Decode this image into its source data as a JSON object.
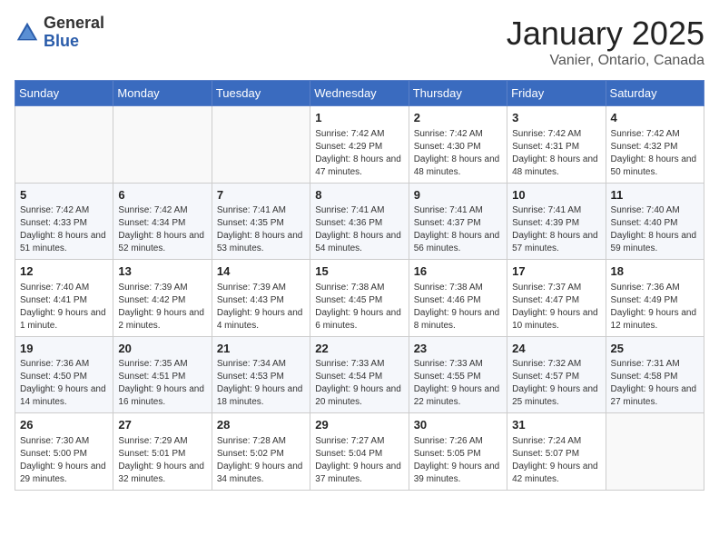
{
  "logo": {
    "general": "General",
    "blue": "Blue"
  },
  "header": {
    "month": "January 2025",
    "location": "Vanier, Ontario, Canada"
  },
  "weekdays": [
    "Sunday",
    "Monday",
    "Tuesday",
    "Wednesday",
    "Thursday",
    "Friday",
    "Saturday"
  ],
  "weeks": [
    [
      {
        "day": "",
        "info": ""
      },
      {
        "day": "",
        "info": ""
      },
      {
        "day": "",
        "info": ""
      },
      {
        "day": "1",
        "info": "Sunrise: 7:42 AM\nSunset: 4:29 PM\nDaylight: 8 hours and 47 minutes."
      },
      {
        "day": "2",
        "info": "Sunrise: 7:42 AM\nSunset: 4:30 PM\nDaylight: 8 hours and 48 minutes."
      },
      {
        "day": "3",
        "info": "Sunrise: 7:42 AM\nSunset: 4:31 PM\nDaylight: 8 hours and 48 minutes."
      },
      {
        "day": "4",
        "info": "Sunrise: 7:42 AM\nSunset: 4:32 PM\nDaylight: 8 hours and 50 minutes."
      }
    ],
    [
      {
        "day": "5",
        "info": "Sunrise: 7:42 AM\nSunset: 4:33 PM\nDaylight: 8 hours and 51 minutes."
      },
      {
        "day": "6",
        "info": "Sunrise: 7:42 AM\nSunset: 4:34 PM\nDaylight: 8 hours and 52 minutes."
      },
      {
        "day": "7",
        "info": "Sunrise: 7:41 AM\nSunset: 4:35 PM\nDaylight: 8 hours and 53 minutes."
      },
      {
        "day": "8",
        "info": "Sunrise: 7:41 AM\nSunset: 4:36 PM\nDaylight: 8 hours and 54 minutes."
      },
      {
        "day": "9",
        "info": "Sunrise: 7:41 AM\nSunset: 4:37 PM\nDaylight: 8 hours and 56 minutes."
      },
      {
        "day": "10",
        "info": "Sunrise: 7:41 AM\nSunset: 4:39 PM\nDaylight: 8 hours and 57 minutes."
      },
      {
        "day": "11",
        "info": "Sunrise: 7:40 AM\nSunset: 4:40 PM\nDaylight: 8 hours and 59 minutes."
      }
    ],
    [
      {
        "day": "12",
        "info": "Sunrise: 7:40 AM\nSunset: 4:41 PM\nDaylight: 9 hours and 1 minute."
      },
      {
        "day": "13",
        "info": "Sunrise: 7:39 AM\nSunset: 4:42 PM\nDaylight: 9 hours and 2 minutes."
      },
      {
        "day": "14",
        "info": "Sunrise: 7:39 AM\nSunset: 4:43 PM\nDaylight: 9 hours and 4 minutes."
      },
      {
        "day": "15",
        "info": "Sunrise: 7:38 AM\nSunset: 4:45 PM\nDaylight: 9 hours and 6 minutes."
      },
      {
        "day": "16",
        "info": "Sunrise: 7:38 AM\nSunset: 4:46 PM\nDaylight: 9 hours and 8 minutes."
      },
      {
        "day": "17",
        "info": "Sunrise: 7:37 AM\nSunset: 4:47 PM\nDaylight: 9 hours and 10 minutes."
      },
      {
        "day": "18",
        "info": "Sunrise: 7:36 AM\nSunset: 4:49 PM\nDaylight: 9 hours and 12 minutes."
      }
    ],
    [
      {
        "day": "19",
        "info": "Sunrise: 7:36 AM\nSunset: 4:50 PM\nDaylight: 9 hours and 14 minutes."
      },
      {
        "day": "20",
        "info": "Sunrise: 7:35 AM\nSunset: 4:51 PM\nDaylight: 9 hours and 16 minutes."
      },
      {
        "day": "21",
        "info": "Sunrise: 7:34 AM\nSunset: 4:53 PM\nDaylight: 9 hours and 18 minutes."
      },
      {
        "day": "22",
        "info": "Sunrise: 7:33 AM\nSunset: 4:54 PM\nDaylight: 9 hours and 20 minutes."
      },
      {
        "day": "23",
        "info": "Sunrise: 7:33 AM\nSunset: 4:55 PM\nDaylight: 9 hours and 22 minutes."
      },
      {
        "day": "24",
        "info": "Sunrise: 7:32 AM\nSunset: 4:57 PM\nDaylight: 9 hours and 25 minutes."
      },
      {
        "day": "25",
        "info": "Sunrise: 7:31 AM\nSunset: 4:58 PM\nDaylight: 9 hours and 27 minutes."
      }
    ],
    [
      {
        "day": "26",
        "info": "Sunrise: 7:30 AM\nSunset: 5:00 PM\nDaylight: 9 hours and 29 minutes."
      },
      {
        "day": "27",
        "info": "Sunrise: 7:29 AM\nSunset: 5:01 PM\nDaylight: 9 hours and 32 minutes."
      },
      {
        "day": "28",
        "info": "Sunrise: 7:28 AM\nSunset: 5:02 PM\nDaylight: 9 hours and 34 minutes."
      },
      {
        "day": "29",
        "info": "Sunrise: 7:27 AM\nSunset: 5:04 PM\nDaylight: 9 hours and 37 minutes."
      },
      {
        "day": "30",
        "info": "Sunrise: 7:26 AM\nSunset: 5:05 PM\nDaylight: 9 hours and 39 minutes."
      },
      {
        "day": "31",
        "info": "Sunrise: 7:24 AM\nSunset: 5:07 PM\nDaylight: 9 hours and 42 minutes."
      },
      {
        "day": "",
        "info": ""
      }
    ]
  ]
}
